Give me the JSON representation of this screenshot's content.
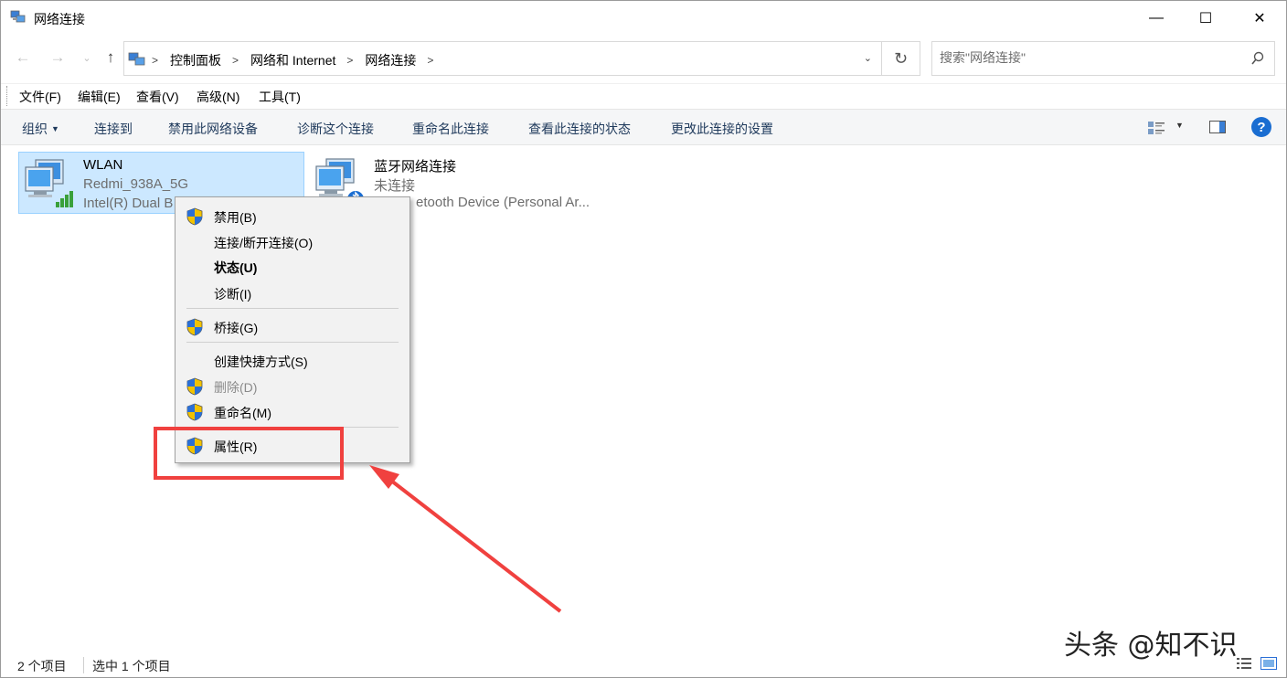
{
  "window": {
    "title": "网络连接",
    "minimize_label": "—",
    "maximize_label": "☐",
    "close_label": "✕"
  },
  "address": {
    "crumbs": [
      "控制面板",
      "网络和 Internet",
      "网络连接"
    ],
    "search_placeholder": "搜索\"网络连接\""
  },
  "menubar": [
    "文件(F)",
    "编辑(E)",
    "查看(V)",
    "高级(N)",
    "工具(T)"
  ],
  "commands": {
    "organize": "组织",
    "connect_to": "连接到",
    "disable_device": "禁用此网络设备",
    "diagnose": "诊断这个连接",
    "rename": "重命名此连接",
    "view_status": "查看此连接的状态",
    "change_settings": "更改此连接的设置",
    "help": "?"
  },
  "connections": [
    {
      "name": "WLAN",
      "network": "Redmi_938A_5G",
      "device": "Intel(R) Dual B"
    },
    {
      "name": "蓝牙网络连接",
      "network": "未连接",
      "device": "etooth Device (Personal Ar..."
    }
  ],
  "context_menu": {
    "disable": "禁用(B)",
    "connect_disconnect": "连接/断开连接(O)",
    "status": "状态(U)",
    "diagnose": "诊断(I)",
    "bridge": "桥接(G)",
    "create_shortcut": "创建快捷方式(S)",
    "delete": "删除(D)",
    "rename": "重命名(M)",
    "properties": "属性(R)"
  },
  "status": {
    "item_count": "2 个项目",
    "selected": "选中 1 个项目"
  },
  "watermark": "头条 @知不识",
  "colors": {
    "selection_bg": "#cce8ff",
    "command_text": "#1e395b",
    "annotation_red": "#f0413f",
    "help_blue": "#1a6dd1"
  }
}
